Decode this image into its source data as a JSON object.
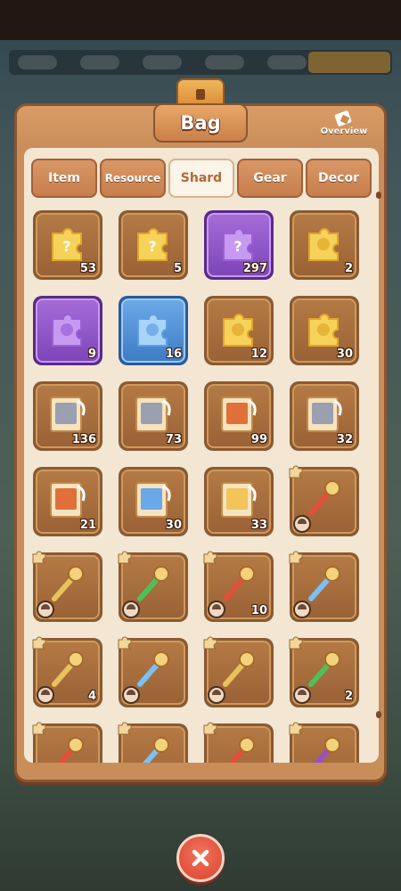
{
  "window": {
    "title": "Bag",
    "overview_label": "Overview"
  },
  "tabs": [
    {
      "label": "Item",
      "active": false
    },
    {
      "label": "Resource",
      "active": false
    },
    {
      "label": "Shard",
      "active": true
    },
    {
      "label": "Gear",
      "active": false
    },
    {
      "label": "Decor",
      "active": false
    }
  ],
  "items": [
    {
      "icon": "mystery-tag-icon",
      "count": "53",
      "rarity": "gold"
    },
    {
      "icon": "mystery-puzzle-gold-icon",
      "count": "5",
      "rarity": "gold"
    },
    {
      "icon": "mystery-puzzle-purple-icon",
      "count": "297",
      "rarity": "purple"
    },
    {
      "icon": "hero-silhouette-puzzle-gold-icon",
      "count": "2",
      "rarity": "gold"
    },
    {
      "icon": "hero-silhouette-puzzle-purple-icon",
      "count": "9",
      "rarity": "purple"
    },
    {
      "icon": "hero-silhouette-puzzle-blue-icon",
      "count": "16",
      "rarity": "blue"
    },
    {
      "icon": "sword-puzzle-icon",
      "count": "12",
      "rarity": "gold"
    },
    {
      "icon": "blue-flame-crystal-icon",
      "count": "30",
      "rarity": "gold"
    },
    {
      "icon": "hero-card-white-haired-icon",
      "count": "136",
      "rarity": "gold"
    },
    {
      "icon": "hero-card-horned-beast-icon",
      "count": "73",
      "rarity": "gold"
    },
    {
      "icon": "hero-card-orange-dragon-icon",
      "count": "99",
      "rarity": "gold"
    },
    {
      "icon": "hero-card-armored-knight-icon",
      "count": "32",
      "rarity": "gold"
    },
    {
      "icon": "hero-card-fire-beast-icon",
      "count": "21",
      "rarity": "gold"
    },
    {
      "icon": "hero-card-blue-goblin-icon",
      "count": "30",
      "rarity": "gold"
    },
    {
      "icon": "hero-card-mystery-icon",
      "count": "33",
      "rarity": "gold"
    },
    {
      "icon": "flame-spear-gear-icon",
      "count": "",
      "rarity": "gold"
    },
    {
      "icon": "golden-hammer-gear-icon",
      "count": "",
      "rarity": "gold"
    },
    {
      "icon": "vine-staff-gear-icon",
      "count": "",
      "rarity": "gold"
    },
    {
      "icon": "crimson-blade-gear-icon",
      "count": "10",
      "rarity": "gold"
    },
    {
      "icon": "crystal-orb-staff-gear-icon",
      "count": "",
      "rarity": "gold"
    },
    {
      "icon": "silver-hammer-gear-icon",
      "count": "4",
      "rarity": "gold"
    },
    {
      "icon": "ice-crystal-staff-gear-icon",
      "count": "",
      "rarity": "gold"
    },
    {
      "icon": "golden-rod-gear-icon",
      "count": "",
      "rarity": "gold"
    },
    {
      "icon": "emerald-ring-gear-icon",
      "count": "2",
      "rarity": "gold"
    },
    {
      "icon": "red-eye-ring-gear-icon",
      "count": "",
      "rarity": "gold"
    },
    {
      "icon": "ice-crown-gear-icon",
      "count": "",
      "rarity": "gold"
    },
    {
      "icon": "fire-amulet-gear-icon",
      "count": "",
      "rarity": "gold"
    },
    {
      "icon": "purple-cloak-gear-icon",
      "count": "",
      "rarity": "gold"
    }
  ],
  "colors": {
    "panel": "#c98d5a",
    "inner": "#f3e6d2",
    "close": "#e8553c"
  }
}
